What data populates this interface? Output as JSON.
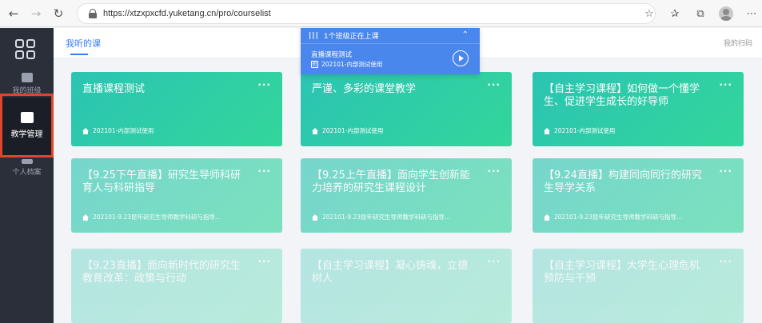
{
  "browser": {
    "url": "https://xtzxpxcfd.yuketang.cn/pro/courselist"
  },
  "sidebar": {
    "items": [
      {
        "label": "我的班级",
        "icon": "class-icon"
      },
      {
        "label": "教学管理",
        "icon": "teaching-icon",
        "active": true
      },
      {
        "label": "个人档案",
        "icon": "profile-icon"
      }
    ]
  },
  "topnav": {
    "tab": "我听的课",
    "right_link": "我的扫码"
  },
  "live_panel": {
    "header": "1个班级正在上课",
    "course": "直播课程测试",
    "class": "202101-内部测试使用"
  },
  "courses": [
    {
      "title": "直播课程测试",
      "class": "202101-内部测试使用"
    },
    {
      "title": "严谨、多彩的课堂教学",
      "class": "202101-内部测试使用"
    },
    {
      "title": "【自主学习课程】如何做一个懂学生、促进学生成长的好导师",
      "class": "202101-内部测试使用"
    },
    {
      "title": "【9.25下午直播】研究生导师科研育人与科研指导",
      "class": "202101-9.23昆年研究生导师教学科研与指导..."
    },
    {
      "title": "【9.25上午直播】面向学生创新能力培养的研究生课程设计",
      "class": "202101-9.23昆年研究生导师教学科研与指导..."
    },
    {
      "title": "【9.24直播】构建同向同行的研究生导学关系",
      "class": "202101-9.23昆年研究生导师教学科研与指导..."
    },
    {
      "title": "【9.23直播】面向新时代的研究生教育改革：政策与行动",
      "class": ""
    },
    {
      "title": "【自主学习课程】凝心铸魂，立德树人",
      "class": ""
    },
    {
      "title": "【自主学习课程】大学生心理危机预防与干预",
      "class": ""
    }
  ],
  "colors": {
    "accent": "#3a7cf5",
    "card_gradient_start": "#2bc4b3",
    "card_gradient_end": "#33d69b",
    "sidebar_bg": "#2b2f3a",
    "highlight": "#e0442b",
    "live_panel_bg": "#4a87ec"
  }
}
